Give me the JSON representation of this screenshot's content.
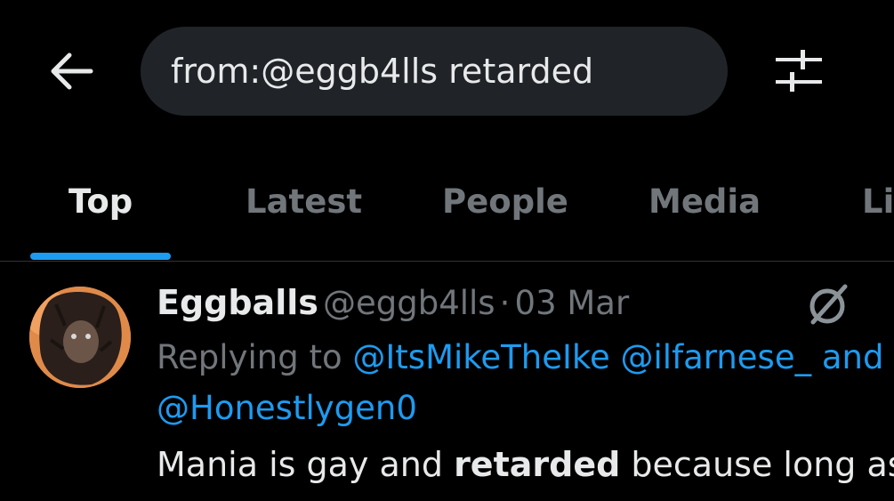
{
  "header": {
    "search_query": "from:@eggb4lls retarded"
  },
  "tabs": [
    {
      "label": "Top",
      "active": true
    },
    {
      "label": "Latest",
      "active": false
    },
    {
      "label": "People",
      "active": false
    },
    {
      "label": "Media",
      "active": false
    },
    {
      "label": "Li",
      "active": false
    }
  ],
  "tweet": {
    "display_name": "Eggballs",
    "handle": "@eggb4lls",
    "separator": "·",
    "date": "03 Mar",
    "replying_to_label": "Replying to",
    "replying_to_handles": [
      "@ItsMikeTheIke",
      "@ilfarnese_",
      "and"
    ],
    "replying_to_line2": "@Honestlygen0",
    "text_before": "Mania is gay and ",
    "text_bold": "retarded",
    "text_after": " because long ass"
  },
  "colors": {
    "background": "#000000",
    "accent": "#1d9bf0",
    "text_primary": "#e7e9ea",
    "text_secondary": "#71767b",
    "search_bg": "#202327"
  },
  "icons": [
    "back-arrow-icon",
    "filter-sliders-icon",
    "grok-icon"
  ]
}
